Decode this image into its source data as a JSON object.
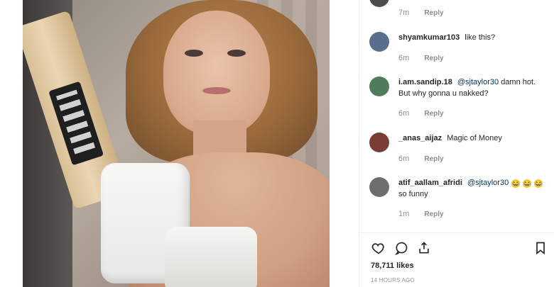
{
  "post": {
    "image_subject": "photo"
  },
  "comments": [
    {
      "username": "",
      "text": "",
      "time": "7m",
      "reply": "Reply"
    },
    {
      "username": "shyamkumar103",
      "text": "like this?",
      "time": "6m",
      "reply": "Reply"
    },
    {
      "username": "i.am.sandip.18",
      "mention": "@sjtaylor30",
      "text": "damn hot. But why gonna u nakked?",
      "time": "6m",
      "reply": "Reply"
    },
    {
      "username": "_anas_aijaz",
      "text": "Magic of Money",
      "time": "6m",
      "reply": "Reply"
    },
    {
      "username": "atif_aallam_afridi",
      "mention": "@sjtaylor30",
      "text": "so funny",
      "emoji_1": "😂",
      "emoji_2": "😂",
      "emoji_3": "😂",
      "time": "1m",
      "reply": "Reply"
    }
  ],
  "actions": {
    "like_icon": "heart-icon",
    "comment_icon": "comment-icon",
    "share_icon": "share-icon",
    "save_icon": "bookmark-icon"
  },
  "likes": "78,711 likes",
  "timestamp": "14 HOURS AGO",
  "colors": {
    "text": "#262626",
    "muted": "#8e8e8e",
    "mention": "#003569",
    "border": "#efefef"
  }
}
